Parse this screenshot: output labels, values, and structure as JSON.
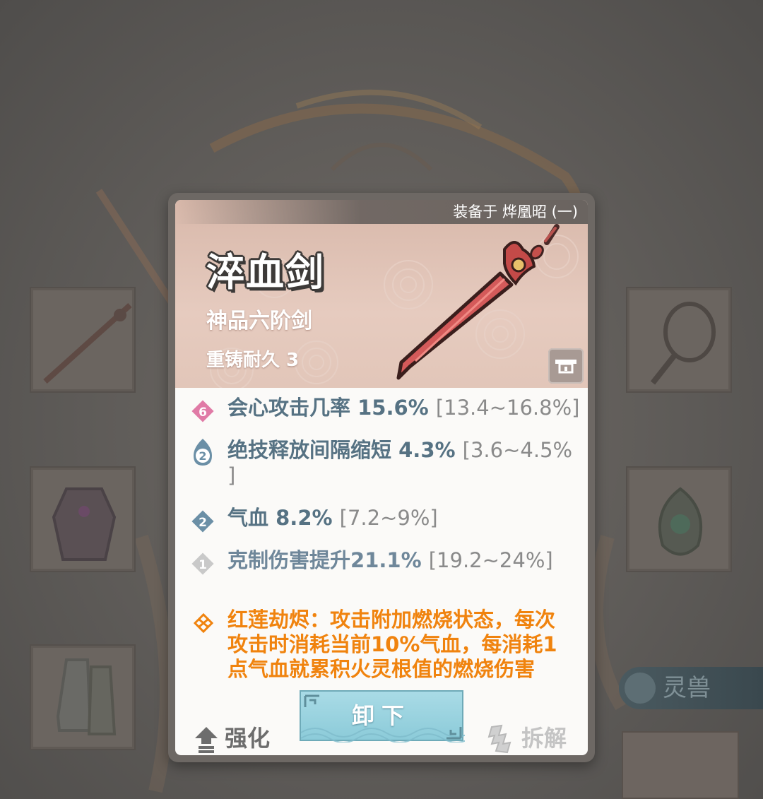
{
  "background": {
    "side_button_label": "灵兽"
  },
  "item": {
    "equipped_on": "装备于 烨凰昭 (一)",
    "name": "淬血剑",
    "grade": "神品六阶剑",
    "durability": "重铸耐久 3"
  },
  "stats": [
    {
      "rank": "6",
      "name": "会心攻击几率",
      "value": "15.6%",
      "range": "[13.4~16.8%]",
      "badge_color": "#e07aa6",
      "badge_shape": "diamond"
    },
    {
      "rank": "2",
      "name": "绝技释放间隔缩短",
      "value": "4.3%",
      "range": "[3.6~4.5%",
      "range_wrap": "]",
      "badge_color": "#6b8fa6",
      "badge_shape": "flame"
    },
    {
      "rank": "2",
      "name": "气血",
      "value": "8.2%",
      "range": "[7.2~9%]",
      "badge_color": "#6b8fa6",
      "badge_shape": "diamond"
    },
    {
      "rank": "1",
      "name": "克制伤害提升",
      "value": "21.1%",
      "range": "[19.2~24%]",
      "badge_color": "#c9c9c9",
      "badge_shape": "diamond"
    }
  ],
  "special": {
    "line1": "红莲劫烬：攻击附加燃烧状态，每次",
    "line2": "攻击时消耗当前10%气血，每消耗1",
    "line3": "点气血就累积火灵根值的燃烧伤害",
    "icon": "fire-lotus-icon",
    "color": "#f0830e"
  },
  "actions": {
    "enhance": "强化",
    "unequip": "卸下",
    "dismantle": "拆解"
  }
}
